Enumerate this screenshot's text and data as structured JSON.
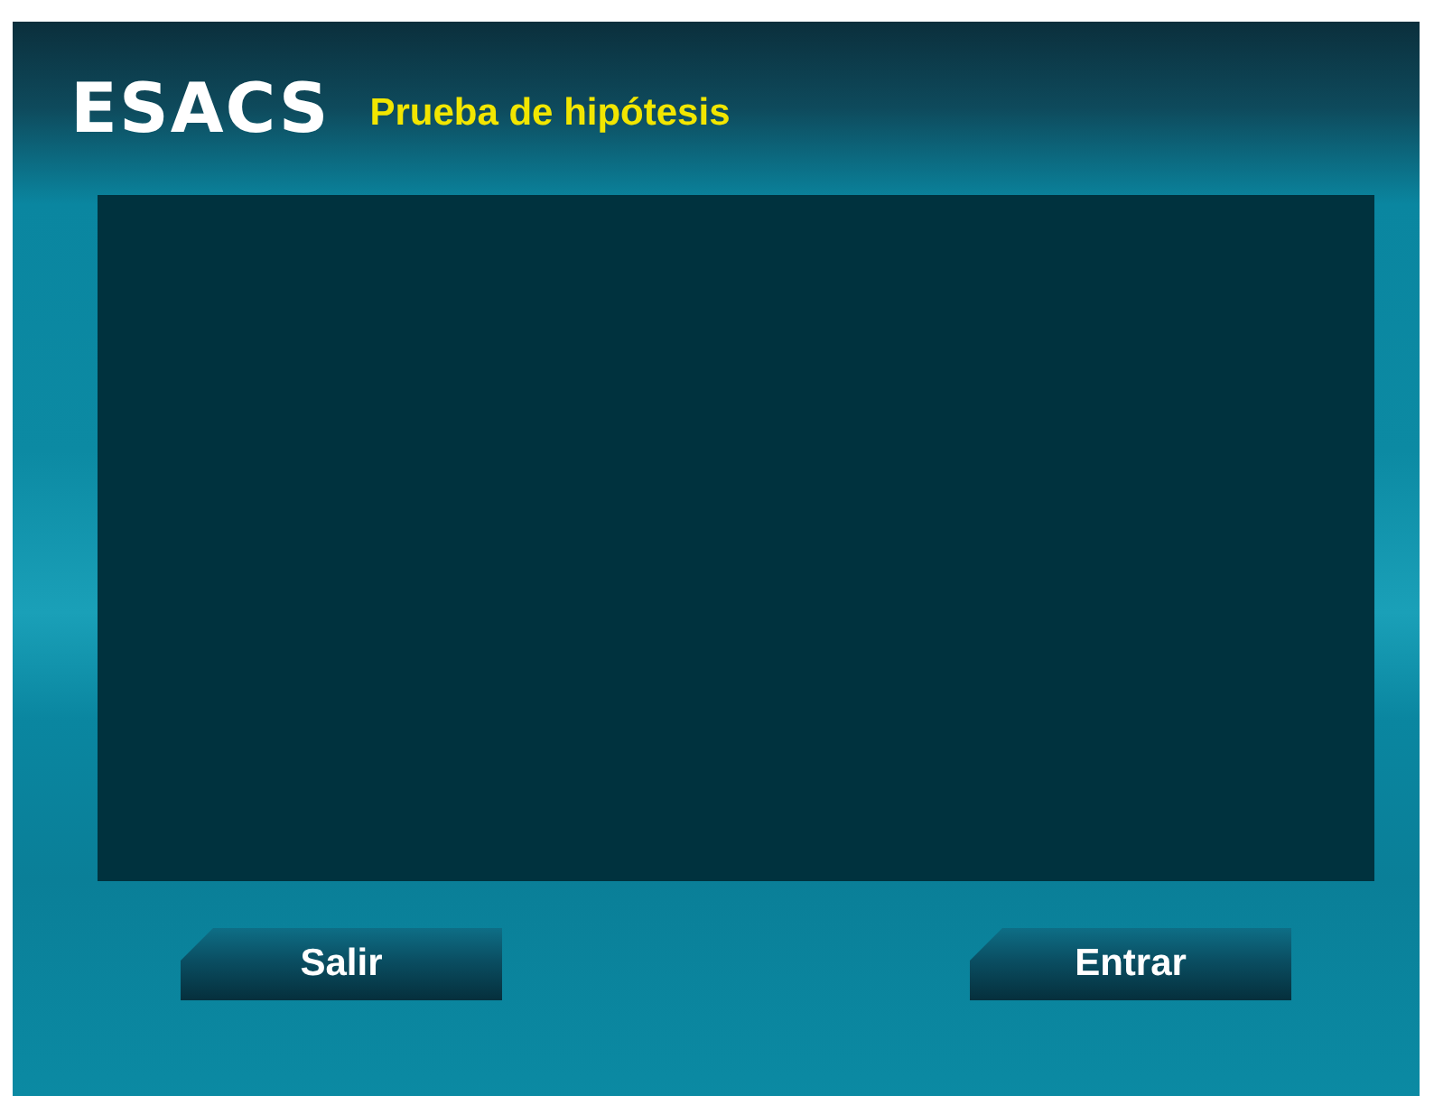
{
  "header": {
    "logo": "ESACS",
    "title": "Prueba de hipótesis"
  },
  "buttons": [
    {
      "label": "Salir"
    },
    {
      "label": "Entrar"
    }
  ]
}
